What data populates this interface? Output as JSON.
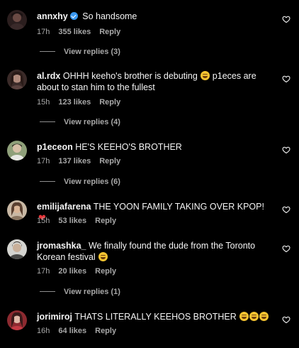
{
  "comments": [
    {
      "username": "annxhy",
      "verified": true,
      "text": "So handsome",
      "time": "17h",
      "likes": "355 likes",
      "reply": "Reply",
      "view_replies": "View replies (3)",
      "avatar_color": "#3a2a2a"
    },
    {
      "username": "al.rdx",
      "text": "OHHH keeho's brother is debuting",
      "text_after_emoji": "p1eces are about to stan him to the fullest",
      "time": "15h",
      "likes": "123 likes",
      "reply": "Reply",
      "view_replies": "View replies (4)",
      "avatar_color": "#5b4340"
    },
    {
      "username": "p1eceon",
      "text": "HE'S KEEHO'S BROTHER",
      "time": "17h",
      "likes": "137 likes",
      "reply": "Reply",
      "view_replies": "View replies (6)",
      "avatar_color": "#6c7a5a"
    },
    {
      "username": "emilijafarena",
      "text": "THE YOON FAMILY TAKING OVER KPOP!",
      "time": "15h",
      "likes": "53 likes",
      "reply": "Reply",
      "avatar_color": "#8a7560"
    },
    {
      "username": "jromashka_",
      "text": "We finally found the dude from the Toronto Korean festival",
      "time": "17h",
      "likes": "20 likes",
      "reply": "Reply",
      "view_replies": "View replies (1)",
      "avatar_color": "#9a9a94"
    },
    {
      "username": "jorimiroj",
      "text": "THATS LITERALLY KEEHOS BROTHER",
      "time": "16h",
      "likes": "64 likes",
      "reply": "Reply",
      "avatar_color": "#a8323a"
    }
  ],
  "colors": {
    "background": "#000000",
    "text": "#f5f5f5",
    "muted": "#a8a8a8",
    "verified": "#3897f0",
    "heart_emoji": "#e8373b"
  },
  "icons": {
    "like": "heart-outline-icon",
    "verified": "verified-badge-icon",
    "emoji": "grinning-emoji-icon"
  }
}
